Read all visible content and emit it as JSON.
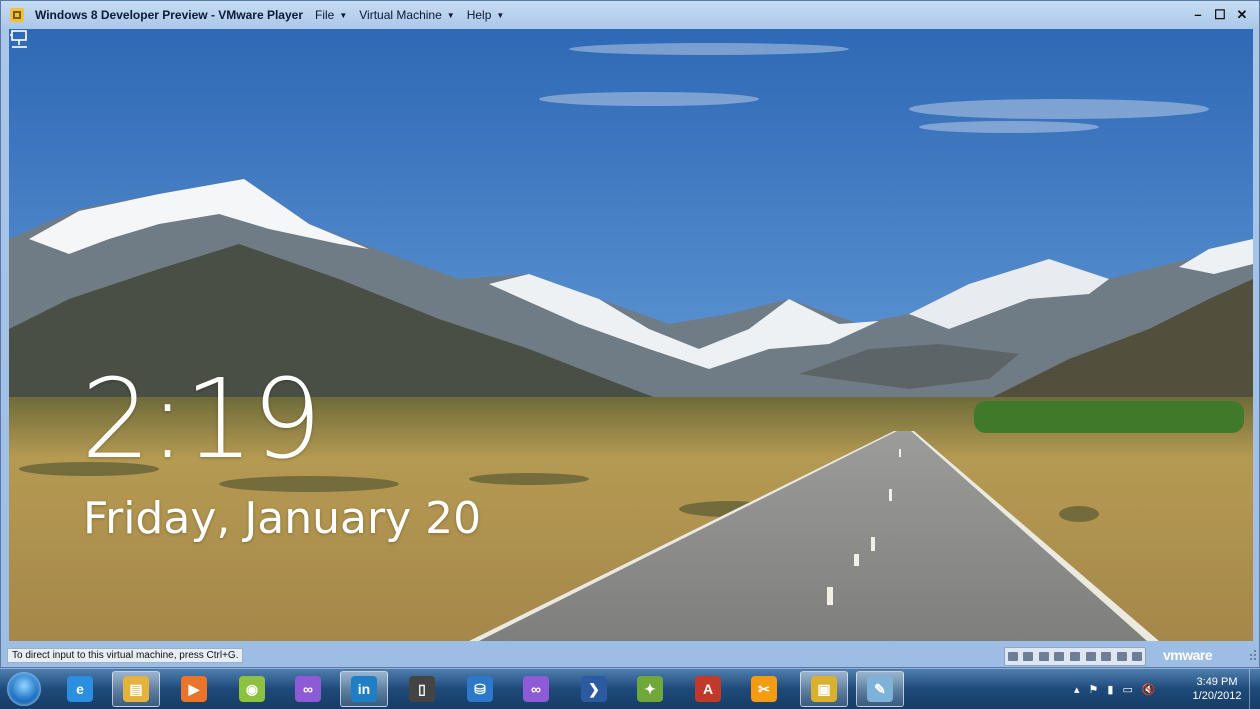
{
  "window": {
    "title": "Windows 8 Developer Preview - VMware Player",
    "menu": [
      {
        "label": "File"
      },
      {
        "label": "Virtual Machine"
      },
      {
        "label": "Help"
      }
    ],
    "controls": {
      "minimize": "–",
      "maximize": "☐",
      "close": "✕"
    }
  },
  "lockscreen": {
    "time": "2:19",
    "date": "Friday, January 20",
    "network_icon": "network-icon"
  },
  "statusbar": {
    "hint": "To direct input to this virtual machine, press Ctrl+G.",
    "brand": "vmware"
  },
  "taskbar": {
    "start": "start-orb",
    "apps": [
      {
        "name": "internet-explorer",
        "glyph": "e",
        "color": "#2a8fe0"
      },
      {
        "name": "windows-explorer",
        "glyph": "▤",
        "color": "#e3b33c",
        "active": true
      },
      {
        "name": "media-player",
        "glyph": "▶",
        "color": "#e9742a"
      },
      {
        "name": "android-sdk",
        "glyph": "◉",
        "color": "#8cc23f"
      },
      {
        "name": "visual-studio-loop",
        "glyph": "∞",
        "color": "#8d5bd6"
      },
      {
        "name": "linkedin",
        "glyph": "in",
        "color": "#1f7ec4",
        "active": true
      },
      {
        "name": "phone-emulator",
        "glyph": "▯",
        "color": "#444"
      },
      {
        "name": "storage-drive",
        "glyph": "⛁",
        "color": "#2c78c9"
      },
      {
        "name": "visual-studio-2",
        "glyph": "∞",
        "color": "#8d5bd6"
      },
      {
        "name": "powershell",
        "glyph": "❯",
        "color": "#2c5aa0"
      },
      {
        "name": "network-tool",
        "glyph": "✦",
        "color": "#6fa83a"
      },
      {
        "name": "adobe-reader",
        "glyph": "A",
        "color": "#c0392b"
      },
      {
        "name": "tools",
        "glyph": "✂",
        "color": "#f39c12"
      },
      {
        "name": "vmware-player",
        "glyph": "▣",
        "color": "#d9b12e",
        "active": true
      },
      {
        "name": "paint",
        "glyph": "✎",
        "color": "#7fb2d9",
        "active": true
      }
    ],
    "tray_icons": [
      "▴",
      "⚑",
      "▮",
      "▭",
      "🔇"
    ],
    "clock_time": "3:49 PM",
    "clock_date": "1/20/2012"
  }
}
